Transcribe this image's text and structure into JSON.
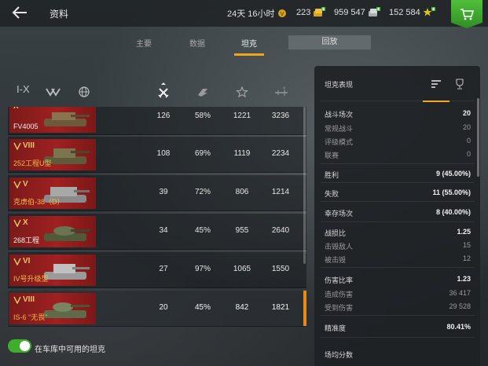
{
  "header": {
    "title": "资料",
    "timer": "24天 16小时",
    "gold": "223",
    "silver": "959 547",
    "free_xp": "152 584"
  },
  "tabs": [
    {
      "label": "主要"
    },
    {
      "label": "数据"
    },
    {
      "label": "坦克"
    },
    {
      "label": "回放"
    }
  ],
  "filters": {
    "tier_label": "I-X"
  },
  "tanks": [
    {
      "tier": "X",
      "name": "FV4005",
      "battles": "126",
      "winrate": "58%",
      "avg_damage": "1221",
      "max_damage": "3236"
    },
    {
      "tier": "VIII",
      "name": "252工程U型",
      "battles": "108",
      "winrate": "69%",
      "avg_damage": "1119",
      "max_damage": "2234"
    },
    {
      "tier": "V",
      "name": "克虏伯-38（D）",
      "battles": "39",
      "winrate": "72%",
      "avg_damage": "806",
      "max_damage": "1214"
    },
    {
      "tier": "X",
      "name": "268工程",
      "battles": "34",
      "winrate": "45%",
      "avg_damage": "955",
      "max_damage": "2640"
    },
    {
      "tier": "VI",
      "name": "IV号升级型",
      "battles": "27",
      "winrate": "97%",
      "avg_damage": "1065",
      "max_damage": "1550"
    },
    {
      "tier": "VIII",
      "name": "IS-6 \"无畏\"",
      "battles": "20",
      "winrate": "45%",
      "avg_damage": "842",
      "max_damage": "1821"
    }
  ],
  "toggle_label": "在车库中可用的坦克",
  "panel": {
    "title": "坦克表现",
    "stats": {
      "battles_label": "战斗场次",
      "battles": "20",
      "regular_label": "常规战斗",
      "regular": "20",
      "rating_label": "评级模式",
      "rating": "0",
      "league_label": "联赛",
      "league": "0",
      "wins_label": "胜利",
      "wins": "9 (45.00%)",
      "losses_label": "失败",
      "losses": "11 (55.00%)",
      "survived_label": "幸存场次",
      "survived": "8 (40.00%)",
      "kd_label": "战损比",
      "kd": "1.25",
      "destroyed_label": "击毁敌人",
      "destroyed": "15",
      "killed_label": "被击毁",
      "killed": "12",
      "dmg_ratio_label": "伤害比率",
      "dmg_ratio": "1.23",
      "dealt_label": "造成伤害",
      "dealt": "36 417",
      "received_label": "受到伤害",
      "received": "29 528",
      "accuracy_label": "精准度",
      "accuracy": "80.41%",
      "avg_score_label": "场均分数"
    }
  },
  "colors": {
    "accent": "#f2a51a",
    "selected_bar": "#e88a18",
    "toggle_on": "#3fae2c",
    "cart_green": "#3fa52e",
    "row_red": "#a02020"
  }
}
